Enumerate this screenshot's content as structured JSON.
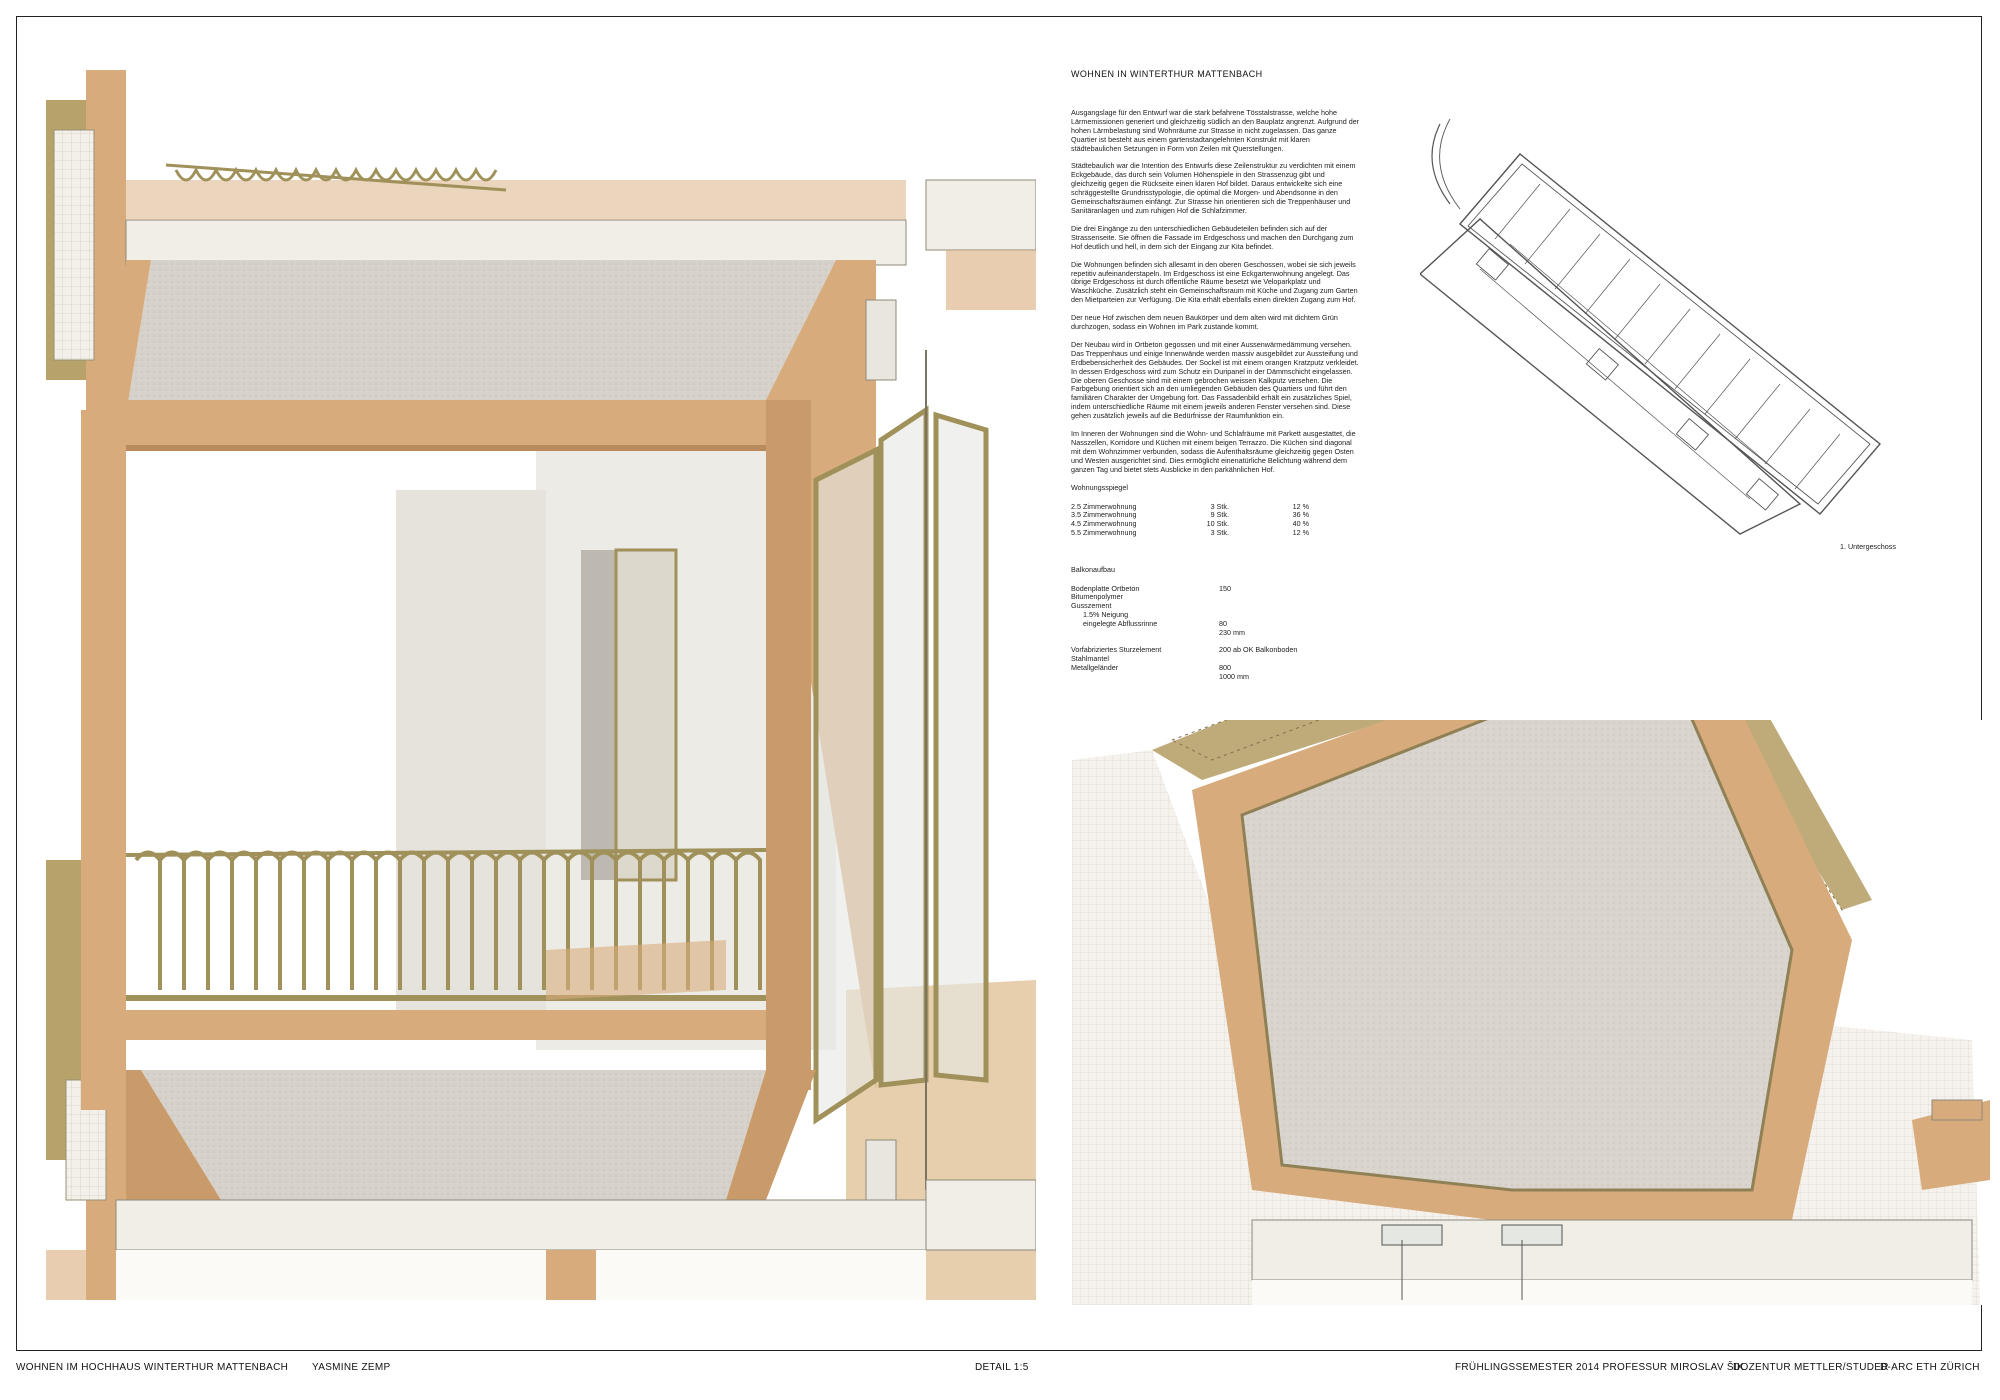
{
  "project": {
    "heading": "WOHNEN IN WINTERTHUR MATTENBACH",
    "paragraphs": [
      "Ausgangslage für den Entwurf war die stark befahrene Tösstalstrasse, welche hohe Lärmemissionen generiert und gleichzeitig südlich an den Bauplatz angrenzt. Aufgrund der hohen Lärmbelastung sind Wohnräume zur Strasse in nicht zugelassen. Das ganze Quartier ist besteht aus einem gartenstadtangelehnten Konstrukt mit klaren städtebaulichen Setzungen in Form von Zeilen mit Querstellungen.",
      "Städtebaulich war die Intention des Entwurfs diese Zeilenstruktur zu verdichten mit einem Eckgebäude, das durch sein Volumen Höhenspiele in den Strassenzug gibt und gleichzeitig gegen die Rückseite einen klaren Hof bildet. Daraus entwickelte sich eine schräggestellte Grundrisstypologie, die optimal die Morgen- und Abendsonne in den Gemeinschaftsräumen einfängt. Zur Strasse hin orientieren sich die Treppenhäuser und Sanitäranlagen und zum ruhigen Hof die Schlafzimmer.",
      "Die drei Eingänge zu den unterschiedlichen Gebäudeteilen befinden sich auf der Strassenseite. Sie öffnen die Fassade im Erdgeschoss und machen den Durchgang zum Hof deutlich und hell, in dem sich der Eingang zur Kita befindet.",
      "Die Wohnungen befinden sich allesamt in den oberen Geschossen, wobei sie sich jeweils repetitiv aufeinanderstapeln. Im Erdgeschoss ist eine Eckgartenwohnung angelegt. Das übrige Erdgeschoss ist durch öffentliche Räume besetzt wie Velopark­platz und Waschküche. Zusätzlich steht ein Gemeinschaftsraum mit Küche und Zugang zum Garten den Mietparteien zur Verfügung. Die Kita erhält ebenfalls einen direkten Zugang zum Hof.",
      "Der neue Hof zwischen dem neuen Baukörper und dem alten wird mit dichtem Grün durchzogen, sodass ein Wohnen im Park zustande kommt.",
      "Der Neubau wird in Ortbeton gegossen und mit einer Aussenwärmedämmung versehen. Das Treppenhaus und einige Innenwände werden massiv ausgebildet zur Aussteifung und Erdbebensicherheit des Gebäudes. Der Sockel ist mit einem orangen Kratzputz verkleidet. In dessen Erdgeschoss wird zum Schutz ein Duripanel in der Dämmschicht eingelassen. Die oberen Geschosse sind mit einem gebrochen weissen Kalkputz versehen. Die Farbgebung orientiert sich an den umliegenden Gebäuden des Quartiers und führt den familiären Charakter der Umgebung fort. Das Fassadenbild erhält ein zusätzliches Spiel, indem unterschiedliche Räume mit einem jeweils anderen Fenster versehen sind. Diese gehen zusätzlich jeweils auf die Bedürfnisse der Raumfunktion ein.",
      "Im Inneren der Wohnungen sind die Wohn- und Schlafräume mit Parkett ausgestattet, die Nasszellen, Korridore und Küchen mit einem beigen Terrazzo. Die Küchen sind diagonal mit dem Wohnzimmer verbunden, sodass die Aufenthaltsräume gleichzeitig gegen Osten und Westen ausgerichtet sind. Dies ermöglicht einenatürliche Belichtung während dem ganzen Tag und bietet stets Ausblicke in den parkähnlichen Hof."
    ]
  },
  "apartment_mix": {
    "title": "Wohnungsspiegel",
    "rows": [
      {
        "type": "2.5 Zimmerwohnung",
        "count": "3 Stk.",
        "share": "12 %"
      },
      {
        "type": "3.5 Zimmerwohnung",
        "count": "9 Stk.",
        "share": "36 %"
      },
      {
        "type": "4.5 Zimmerwohnung",
        "count": "10 Stk.",
        "share": "40 %"
      },
      {
        "type": "5.5 Zimmerwohnung",
        "count": "3 Stk.",
        "share": "12 %"
      }
    ]
  },
  "balcony_build_up": {
    "title": "Balkonaufbau",
    "rows": [
      {
        "label": "Bodenplatte Ortbeton",
        "value": "150"
      },
      {
        "label": "Bitumenpolymer",
        "value": ""
      },
      {
        "label": "Gusszement",
        "value": ""
      },
      {
        "label": "      1.5% Neigung",
        "value": ""
      },
      {
        "label": "      eingelegte Abflussrinne",
        "value": "80"
      },
      {
        "label": "",
        "value": "230 mm"
      },
      {
        "label": "",
        "value": ""
      },
      {
        "label": "Vorfabriziertes Sturzelement",
        "value": "200 ab OK Balkonboden"
      },
      {
        "label": "Stahlmantel",
        "value": ""
      },
      {
        "label": "Metallgeländer",
        "value": "800"
      },
      {
        "label": "",
        "value": "1000 mm"
      }
    ]
  },
  "plan": {
    "caption": "1. Untergeschoss"
  },
  "footer": {
    "project": "WOHNEN IM HOCHHAUS WINTERTHUR MATTENBACH",
    "author": "YASMINE ZEMP",
    "scale": "DETAIL 1:5",
    "semester": "FRÜHLINGSSEMESTER 2014 PROFESSUR MIROSLAV ŠIK",
    "lecturers": "DOZENTUR METTLER/STUDER",
    "school": "D-ARC ETH ZÜRICH"
  },
  "colors": {
    "wood": "#d8ab7c",
    "wood_dark": "#b98a5b",
    "brass": "#a0915a",
    "concrete": "#cfcac2",
    "insulation": "#f1eee8",
    "wall": "#e8e6e0"
  }
}
